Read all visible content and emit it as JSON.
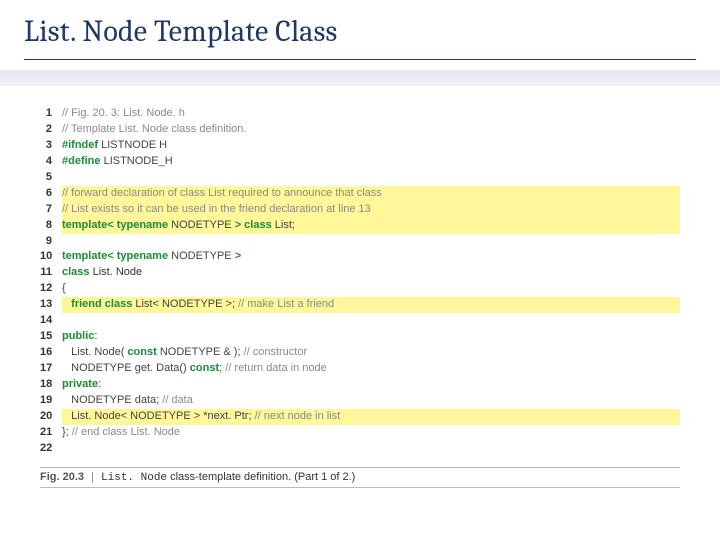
{
  "title": "List. Node Template Class",
  "code": {
    "lines": [
      {
        "n": 1,
        "hl": false,
        "segs": [
          {
            "t": "// Fig. 20. 3: List. Node. h",
            "c": "cmt"
          }
        ]
      },
      {
        "n": 2,
        "hl": false,
        "segs": [
          {
            "t": "// Template List. Node class definition.",
            "c": "cmt"
          }
        ]
      },
      {
        "n": 3,
        "hl": false,
        "segs": [
          {
            "t": "#ifndef",
            "c": "macro"
          },
          {
            "t": " LISTNODE H",
            "c": "plain"
          }
        ]
      },
      {
        "n": 4,
        "hl": false,
        "segs": [
          {
            "t": "#define",
            "c": "macro"
          },
          {
            "t": " LISTNODE_H",
            "c": "plain"
          }
        ]
      },
      {
        "n": 5,
        "hl": false,
        "segs": [
          {
            "t": "",
            "c": "plain"
          }
        ]
      },
      {
        "n": 6,
        "hl": true,
        "segs": [
          {
            "t": "// forward declaration of class List required to announce that class",
            "c": "cmt"
          }
        ]
      },
      {
        "n": 7,
        "hl": true,
        "segs": [
          {
            "t": "// List exists so it can be used in the friend declaration at line 13",
            "c": "cmt"
          }
        ]
      },
      {
        "n": 8,
        "hl": true,
        "segs": [
          {
            "t": "template< typename",
            "c": "kw"
          },
          {
            "t": " NODETYPE ",
            "c": "plain"
          },
          {
            "t": "> class",
            "c": "kw"
          },
          {
            "t": " List;",
            "c": "plain"
          }
        ]
      },
      {
        "n": 9,
        "hl": false,
        "segs": [
          {
            "t": "",
            "c": "plain"
          }
        ]
      },
      {
        "n": 10,
        "hl": false,
        "segs": [
          {
            "t": "template< typename",
            "c": "kw"
          },
          {
            "t": " NODETYPE ",
            "c": "plain"
          },
          {
            "t": ">",
            "c": "kw"
          }
        ]
      },
      {
        "n": 11,
        "hl": false,
        "segs": [
          {
            "t": "class",
            "c": "kw"
          },
          {
            "t": " List. Node",
            "c": "ident"
          }
        ]
      },
      {
        "n": 12,
        "hl": false,
        "segs": [
          {
            "t": "{",
            "c": "plain"
          }
        ]
      },
      {
        "n": 13,
        "hl": true,
        "segs": [
          {
            "t": "   ",
            "c": "plain"
          },
          {
            "t": "friend class",
            "c": "kw"
          },
          {
            "t": " List< NODETYPE >; ",
            "c": "plain"
          },
          {
            "t": "// make List a friend",
            "c": "cmt"
          }
        ]
      },
      {
        "n": 14,
        "hl": false,
        "segs": [
          {
            "t": "",
            "c": "plain"
          }
        ]
      },
      {
        "n": 15,
        "hl": false,
        "segs": [
          {
            "t": "public",
            "c": "kw"
          },
          {
            "t": ":",
            "c": "plain"
          }
        ]
      },
      {
        "n": 16,
        "hl": false,
        "segs": [
          {
            "t": "   List. Node( ",
            "c": "plain"
          },
          {
            "t": "const",
            "c": "kw"
          },
          {
            "t": " NODETYPE & ); ",
            "c": "plain"
          },
          {
            "t": "// constructor",
            "c": "cmt"
          }
        ]
      },
      {
        "n": 17,
        "hl": false,
        "segs": [
          {
            "t": "   NODETYPE get. Data() ",
            "c": "plain"
          },
          {
            "t": "const",
            "c": "kw"
          },
          {
            "t": "; ",
            "c": "plain"
          },
          {
            "t": "// return data in node",
            "c": "cmt"
          }
        ]
      },
      {
        "n": 18,
        "hl": false,
        "segs": [
          {
            "t": "private",
            "c": "kw"
          },
          {
            "t": ":",
            "c": "plain"
          }
        ]
      },
      {
        "n": 19,
        "hl": false,
        "segs": [
          {
            "t": "   NODETYPE data; ",
            "c": "plain"
          },
          {
            "t": "// data",
            "c": "cmt"
          }
        ]
      },
      {
        "n": 20,
        "hl": true,
        "segs": [
          {
            "t": "   List. Node< NODETYPE > *next. Ptr; ",
            "c": "plain"
          },
          {
            "t": "// next node in list",
            "c": "cmt"
          }
        ]
      },
      {
        "n": 21,
        "hl": false,
        "segs": [
          {
            "t": "}; ",
            "c": "plain"
          },
          {
            "t": "// end class List. Node",
            "c": "cmt"
          }
        ]
      },
      {
        "n": 22,
        "hl": false,
        "segs": [
          {
            "t": "",
            "c": "plain"
          }
        ]
      }
    ]
  },
  "caption": {
    "figlabel": "Fig. 20.3",
    "sep": "|",
    "text_pre": " ",
    "mono": "List. Node",
    "text_post": " class-template definition. (Part 1 of 2.)"
  }
}
